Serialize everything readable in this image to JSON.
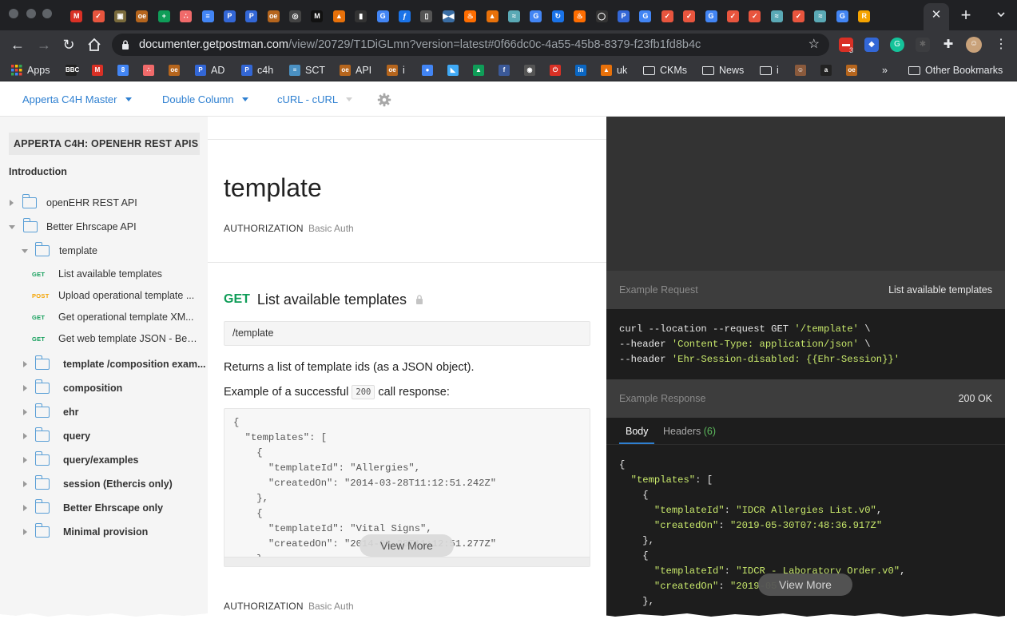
{
  "browser": {
    "active_tab_close": "✕",
    "new_tab": "+",
    "url_host": "documenter.getpostman.com",
    "url_path": "/view/20729/T1DiGLmn?version=latest#0f66dc0c-4a55-45b8-8379-f23fb1fd8b4c",
    "tab_favicons": [
      {
        "glyph": "M",
        "color": "#d93025"
      },
      {
        "glyph": "✓",
        "color": "#e8553e"
      },
      {
        "glyph": "▣",
        "color": "#7a6b3c"
      },
      {
        "glyph": "oe",
        "color": "#b5651d"
      },
      {
        "glyph": "+",
        "color": "#0f9d58"
      },
      {
        "glyph": "∴",
        "color": "#f06a6a"
      },
      {
        "glyph": "≡",
        "color": "#4285f4"
      },
      {
        "glyph": "P",
        "color": "#3367d6"
      },
      {
        "glyph": "P",
        "color": "#3367d6"
      },
      {
        "glyph": "oe",
        "color": "#b5651d"
      },
      {
        "glyph": "◎",
        "color": "#444"
      },
      {
        "glyph": "M",
        "color": "#111"
      },
      {
        "glyph": "▲",
        "color": "#e8710a"
      },
      {
        "glyph": "▮",
        "color": "#333"
      },
      {
        "glyph": "G",
        "color": "#4285f4"
      },
      {
        "glyph": "ƒ",
        "color": "#1a73e8"
      },
      {
        "glyph": "▯",
        "color": "#555"
      },
      {
        "glyph": "▶◀",
        "color": "#3a6ea5"
      },
      {
        "glyph": "♨",
        "color": "#ff6d00"
      },
      {
        "glyph": "▲",
        "color": "#e8710a"
      },
      {
        "glyph": "≈",
        "color": "#5aa9b5"
      },
      {
        "glyph": "G",
        "color": "#4285f4"
      },
      {
        "glyph": "↻",
        "color": "#1a73e8"
      },
      {
        "glyph": "♨",
        "color": "#ff6d00"
      },
      {
        "glyph": "◯",
        "color": "#333"
      },
      {
        "glyph": "P",
        "color": "#3367d6"
      },
      {
        "glyph": "G",
        "color": "#4285f4"
      },
      {
        "glyph": "✓",
        "color": "#e8553e"
      },
      {
        "glyph": "✓",
        "color": "#e8553e"
      },
      {
        "glyph": "G",
        "color": "#4285f4"
      },
      {
        "glyph": "✓",
        "color": "#e8553e"
      },
      {
        "glyph": "✓",
        "color": "#e8553e"
      },
      {
        "glyph": "≈",
        "color": "#5aa9b5"
      },
      {
        "glyph": "✓",
        "color": "#e8553e"
      },
      {
        "glyph": "≈",
        "color": "#5aa9b5"
      },
      {
        "glyph": "G",
        "color": "#4285f4"
      },
      {
        "glyph": "R",
        "color": "#f4a300"
      }
    ],
    "extensions": {
      "badge_count": "3"
    },
    "bookmarks": [
      {
        "label": "Apps",
        "icon": "apps-grid-icon",
        "color": "#e8710a"
      },
      {
        "label": "",
        "icon": "bbc-icon",
        "color": "#222",
        "glyph": "BBC"
      },
      {
        "label": "",
        "icon": "gmail-icon",
        "color": "#d93025",
        "glyph": "M"
      },
      {
        "label": "",
        "icon": "calendar-icon",
        "color": "#4285f4",
        "glyph": "8"
      },
      {
        "label": "",
        "icon": "asana-icon",
        "color": "#f06a6a",
        "glyph": "∴"
      },
      {
        "label": "",
        "icon": "openehr-icon",
        "color": "#b5651d",
        "glyph": "oe"
      },
      {
        "label": "AD",
        "icon": "postman-icon",
        "color": "#3367d6",
        "glyph": "P"
      },
      {
        "label": "c4h",
        "icon": "postman-icon",
        "color": "#3367d6",
        "glyph": "P"
      },
      {
        "label": "SCT",
        "icon": "snomed-icon",
        "color": "#4a90c2",
        "glyph": "≡"
      },
      {
        "label": "API",
        "icon": "openehr-icon",
        "color": "#b5651d",
        "glyph": "oe"
      },
      {
        "label": "i",
        "icon": "openehr-icon",
        "color": "#b5651d",
        "glyph": "oe"
      },
      {
        "label": "",
        "icon": "contacts-icon",
        "color": "#4285f4",
        "glyph": "●"
      },
      {
        "label": "",
        "icon": "app-icon",
        "color": "#3fa9f5",
        "glyph": "◣"
      },
      {
        "label": "",
        "icon": "drive-icon",
        "color": "#0f9d58",
        "glyph": "▲"
      },
      {
        "label": "",
        "icon": "facebook-icon",
        "color": "#3b5998",
        "glyph": "f"
      },
      {
        "label": "",
        "icon": "github-icon",
        "color": "#555",
        "glyph": "◉"
      },
      {
        "label": "",
        "icon": "power-icon",
        "color": "#d93025",
        "glyph": "⏻"
      },
      {
        "label": "",
        "icon": "linkedin-icon",
        "color": "#0a66c2",
        "glyph": "in"
      },
      {
        "label": "uk",
        "icon": "gitlab-icon",
        "color": "#e8710a",
        "glyph": "▲"
      },
      {
        "label": "CKMs",
        "icon": "folder-icon"
      },
      {
        "label": "News",
        "icon": "folder-icon"
      },
      {
        "label": "i",
        "icon": "folder-icon"
      },
      {
        "label": "",
        "icon": "photo-icon",
        "color": "#8a5a3c",
        "glyph": "☺"
      },
      {
        "label": "",
        "icon": "amazon-icon",
        "color": "#222",
        "glyph": "a"
      },
      {
        "label": "",
        "icon": "openehr-icon",
        "color": "#b5651d",
        "glyph": "oe"
      }
    ],
    "overflow": "»",
    "other_bookmarks": "Other Bookmarks"
  },
  "doc_header": {
    "environment": "Apperta C4H Master",
    "layout": "Double Column",
    "language": "cURL - cURL"
  },
  "sidebar": {
    "collection_title": "APPERTA C4H: OPENEHR REST APIS",
    "introduction": "Introduction",
    "folders_top": [
      {
        "label": "openEHR REST API",
        "expanded": false
      },
      {
        "label": "Better Ehrscape API",
        "expanded": true
      }
    ],
    "subfolder_open": "template",
    "requests": [
      {
        "method": "GET",
        "label": "List available templates"
      },
      {
        "method": "POST",
        "label": "Upload operational template ..."
      },
      {
        "method": "GET",
        "label": "Get operational template XM..."
      },
      {
        "method": "GET",
        "label": "Get web template JSON - Bett..."
      }
    ],
    "subfolders": [
      "template /composition exam...",
      "composition",
      "ehr",
      "query",
      "query/examples",
      "session (Ethercis only)",
      "Better Ehrscape only",
      "Minimal provision"
    ]
  },
  "main": {
    "folder_title": "template",
    "auth_label": "AUTHORIZATION",
    "auth_value": "Basic Auth",
    "request": {
      "method": "GET",
      "name": "List available templates",
      "url": "/template",
      "description": "Returns a list of template ids (as a JSON object).",
      "example_prefix": "Example of a successful",
      "example_code": "200",
      "example_suffix": "call response:",
      "code_sample": "{\n  \"templates\": [\n    {\n      \"templateId\": \"Allergies\",\n      \"createdOn\": \"2014-03-28T11:12:51.242Z\"\n    },\n    {\n      \"templateId\": \"Vital Signs\",\n      \"createdOn\": \"2014-03-28T11:12:51.277Z\"\n    }",
      "view_more": "View More"
    },
    "auth2_label": "AUTHORIZATION",
    "auth2_value": "Basic Auth"
  },
  "right_pane": {
    "example_request_label": "Example Request",
    "example_request_name": "List available templates",
    "curl": {
      "line1_cmd": "curl --location --request GET ",
      "line1_str": "'/template'",
      "line1_tail": " \\",
      "line2_cmd": "--header ",
      "line2_str": "'Content-Type: application/json'",
      "line2_tail": " \\",
      "line3_cmd": "--header ",
      "line3_str": "'Ehr-Session-disabled: {{Ehr-Session}}'"
    },
    "example_response_label": "Example Response",
    "example_response_status": "200 OK",
    "tab_body": "Body",
    "tab_headers": "Headers",
    "tab_headers_count": "(6)",
    "response": {
      "l1": "{",
      "l2_key": "\"templates\"",
      "l2_tail": ": [",
      "l3": "{",
      "l4_key": "\"templateId\"",
      "l4_val": "\"IDCR Allergies List.v0\"",
      "l5_key": "\"createdOn\"",
      "l5_val": "\"2019-05-30T07:48:36.917Z\"",
      "l6": "},",
      "l7": "{",
      "l8_key": "\"templateId\"",
      "l8_val": "\"IDCR - Laboratory Order.v0\"",
      "l9_key": "\"createdOn\"",
      "l9_val": "\"2019-05",
      "l10": "},"
    },
    "view_more": "View More"
  }
}
